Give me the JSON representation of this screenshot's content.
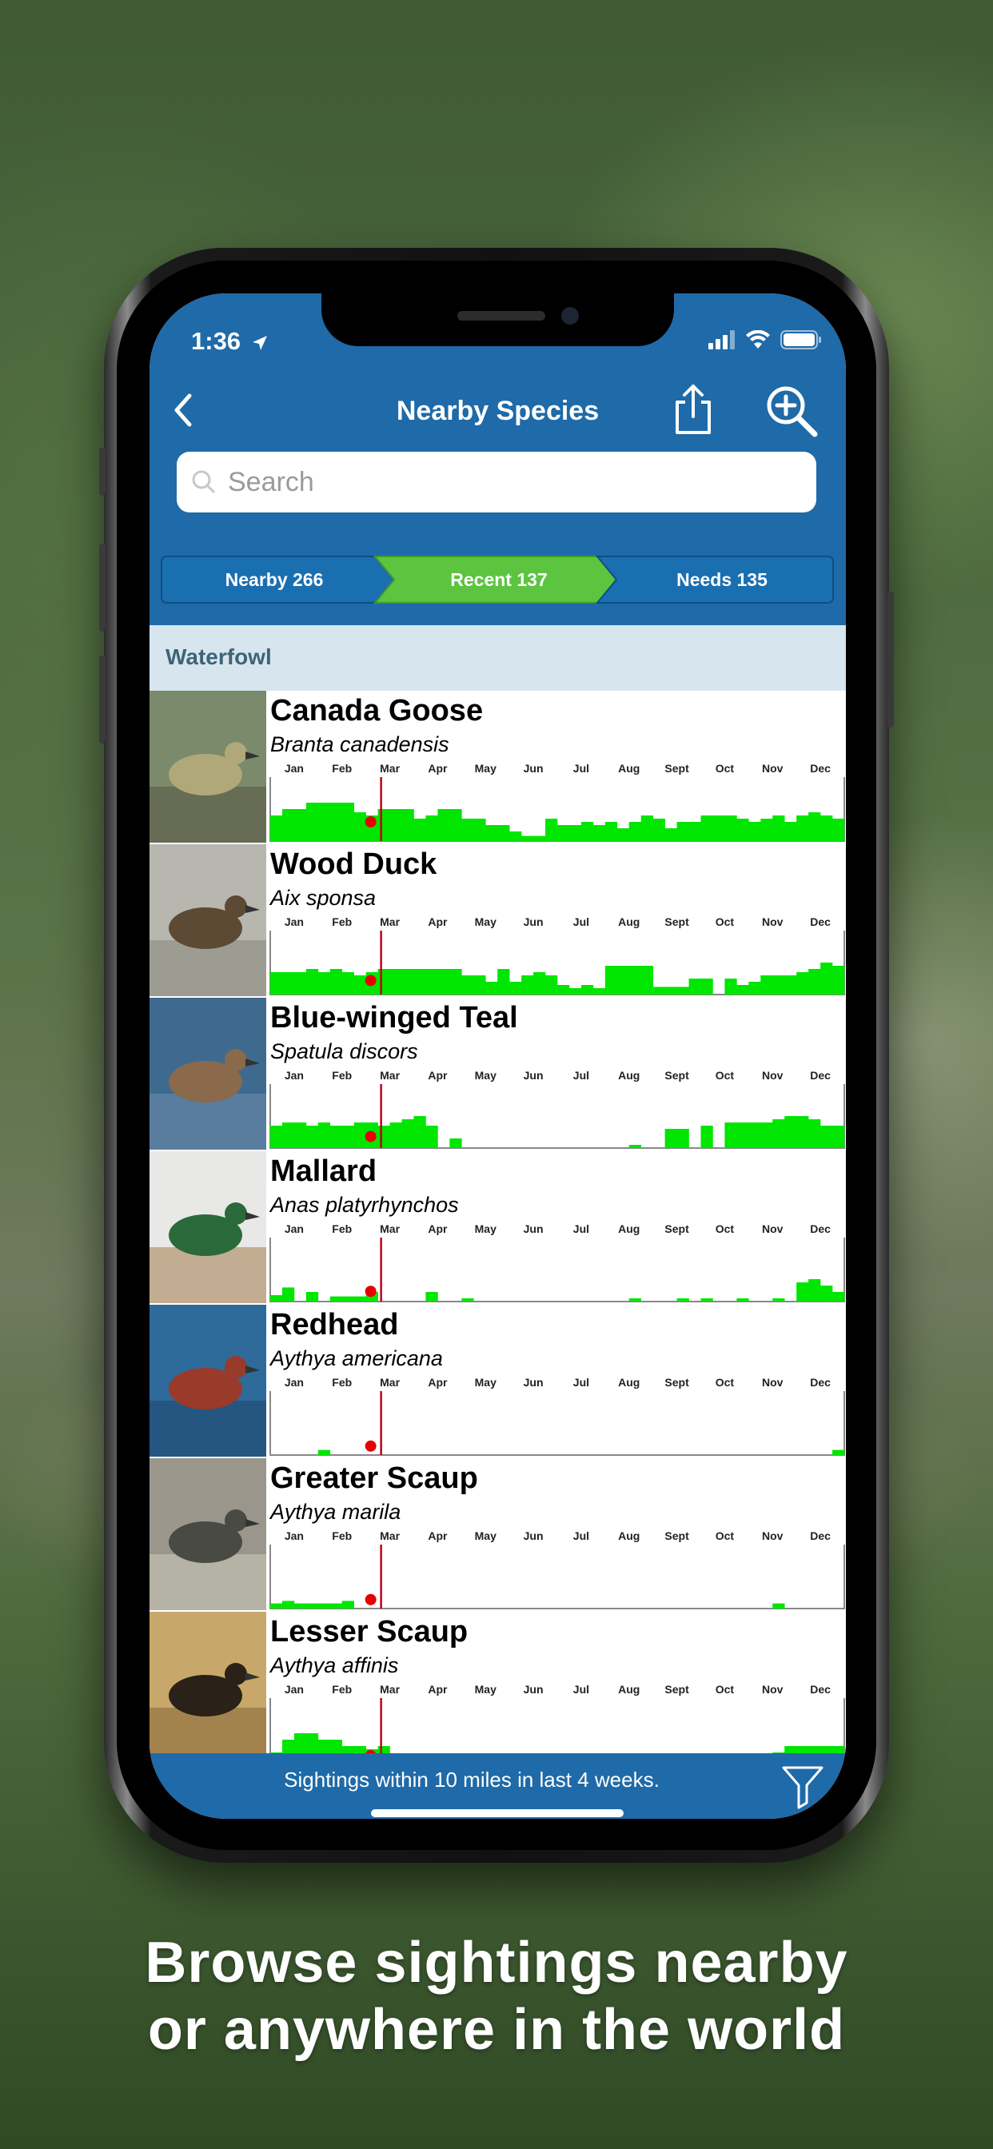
{
  "status_bar": {
    "time": "1:36"
  },
  "nav": {
    "title": "Nearby Species"
  },
  "search": {
    "placeholder": "Search"
  },
  "tabs": [
    {
      "label": "Nearby 266",
      "color": "#1a6fb0",
      "selected": false
    },
    {
      "label": "Recent 137",
      "color": "#5cc43f",
      "selected": true
    },
    {
      "label": "Needs 135",
      "color": "#1a6fb0",
      "selected": false
    }
  ],
  "section": {
    "title": "Waterfowl"
  },
  "months": [
    "Jan",
    "Feb",
    "Mar",
    "Apr",
    "May",
    "Jun",
    "Jul",
    "Aug",
    "Sept",
    "Oct",
    "Nov",
    "Dec"
  ],
  "colors": {
    "bar": "#00e600",
    "marker": "#e60000",
    "current_line": "#c0001a",
    "header": "#1f6aa8"
  },
  "chart_data": {
    "type": "bar",
    "x_unit": "week",
    "weeks_per_year": 48,
    "current_week": 9,
    "species": [
      {
        "common": "Canada Goose",
        "scientific": "Branta canadensis",
        "current_value": 0.2,
        "values": [
          0.4,
          0.5,
          0.5,
          0.6,
          0.6,
          0.6,
          0.6,
          0.45,
          0.4,
          0.5,
          0.5,
          0.5,
          0.35,
          0.4,
          0.5,
          0.5,
          0.35,
          0.35,
          0.25,
          0.25,
          0.15,
          0.08,
          0.08,
          0.35,
          0.25,
          0.25,
          0.3,
          0.25,
          0.3,
          0.2,
          0.3,
          0.4,
          0.35,
          0.2,
          0.3,
          0.3,
          0.4,
          0.4,
          0.4,
          0.35,
          0.3,
          0.35,
          0.4,
          0.3,
          0.4,
          0.45,
          0.4,
          0.35
        ]
      },
      {
        "common": "Wood Duck",
        "scientific": "Aix sponsa",
        "current_value": 0.12,
        "values": [
          0.35,
          0.35,
          0.35,
          0.4,
          0.35,
          0.4,
          0.35,
          0.3,
          0.35,
          0.4,
          0.4,
          0.4,
          0.4,
          0.4,
          0.4,
          0.4,
          0.3,
          0.3,
          0.2,
          0.4,
          0.2,
          0.3,
          0.35,
          0.3,
          0.15,
          0.1,
          0.15,
          0.1,
          0.45,
          0.45,
          0.45,
          0.45,
          0.12,
          0.12,
          0.12,
          0.25,
          0.25,
          0.0,
          0.25,
          0.15,
          0.2,
          0.3,
          0.3,
          0.3,
          0.35,
          0.4,
          0.5,
          0.45
        ]
      },
      {
        "common": "Blue-winged Teal",
        "scientific": "Spatula discors",
        "current_value": 0.08,
        "values": [
          0.35,
          0.4,
          0.4,
          0.35,
          0.4,
          0.35,
          0.35,
          0.4,
          0.4,
          0.35,
          0.4,
          0.45,
          0.5,
          0.35,
          0.0,
          0.15,
          0.0,
          0.0,
          0.0,
          0.0,
          0.0,
          0.0,
          0.0,
          0.0,
          0.0,
          0.0,
          0.0,
          0.0,
          0.0,
          0.0,
          0.05,
          0.0,
          0.0,
          0.3,
          0.3,
          0.0,
          0.35,
          0.0,
          0.4,
          0.4,
          0.4,
          0.4,
          0.45,
          0.5,
          0.5,
          0.45,
          0.35,
          0.35
        ]
      },
      {
        "common": "Mallard",
        "scientific": "Anas platyrhynchos",
        "current_value": 0.06,
        "values": [
          0.1,
          0.22,
          0.0,
          0.15,
          0.0,
          0.08,
          0.08,
          0.08,
          0.15,
          0.0,
          0.0,
          0.0,
          0.0,
          0.15,
          0.0,
          0.0,
          0.05,
          0.0,
          0.0,
          0.0,
          0.0,
          0.0,
          0.0,
          0.0,
          0.0,
          0.0,
          0.0,
          0.0,
          0.0,
          0.0,
          0.05,
          0.0,
          0.0,
          0.0,
          0.05,
          0.0,
          0.05,
          0.0,
          0.0,
          0.05,
          0.0,
          0.0,
          0.05,
          0.0,
          0.3,
          0.35,
          0.25,
          0.15
        ]
      },
      {
        "common": "Redhead",
        "scientific": "Aythya americana",
        "current_value": 0.04,
        "values": [
          0.0,
          0.0,
          0.0,
          0.0,
          0.08,
          0.0,
          0.0,
          0.0,
          0.0,
          0.0,
          0.0,
          0.0,
          0.0,
          0.0,
          0.0,
          0.0,
          0.0,
          0.0,
          0.0,
          0.0,
          0.0,
          0.0,
          0.0,
          0.0,
          0.0,
          0.0,
          0.0,
          0.0,
          0.0,
          0.0,
          0.0,
          0.0,
          0.0,
          0.0,
          0.0,
          0.0,
          0.0,
          0.0,
          0.0,
          0.0,
          0.0,
          0.0,
          0.0,
          0.0,
          0.0,
          0.0,
          0.0,
          0.08
        ]
      },
      {
        "common": "Greater Scaup",
        "scientific": "Aythya marila",
        "current_value": 0.04,
        "values": [
          0.08,
          0.12,
          0.08,
          0.08,
          0.08,
          0.08,
          0.12,
          0.0,
          0.0,
          0.0,
          0.0,
          0.0,
          0.0,
          0.0,
          0.0,
          0.0,
          0.0,
          0.0,
          0.0,
          0.0,
          0.0,
          0.0,
          0.0,
          0.0,
          0.0,
          0.0,
          0.0,
          0.0,
          0.0,
          0.0,
          0.0,
          0.0,
          0.0,
          0.0,
          0.0,
          0.0,
          0.0,
          0.0,
          0.0,
          0.0,
          0.0,
          0.0,
          0.08,
          0.0,
          0.0,
          0.0,
          0.0,
          0.0
        ]
      },
      {
        "common": "Lesser Scaup",
        "scientific": "Aythya affinis",
        "current_value": 0.0,
        "values": [
          0.15,
          0.35,
          0.45,
          0.45,
          0.35,
          0.35,
          0.25,
          0.25,
          0.2,
          0.25,
          0.0,
          0.0,
          0.0,
          0.0,
          0.0,
          0.0,
          0.0,
          0.0,
          0.0,
          0.0,
          0.0,
          0.0,
          0.0,
          0.0,
          0.0,
          0.0,
          0.0,
          0.0,
          0.0,
          0.0,
          0.0,
          0.0,
          0.0,
          0.0,
          0.0,
          0.0,
          0.0,
          0.0,
          0.0,
          0.0,
          0.0,
          0.0,
          0.15,
          0.25,
          0.25,
          0.25,
          0.25,
          0.25
        ]
      }
    ]
  },
  "footer": {
    "text": "Sightings within 10 miles in last 4 weeks."
  },
  "caption": {
    "line1": "Browse sightings nearby",
    "line2": "or anywhere in the world"
  },
  "icons": {
    "back": "chevron-left-icon",
    "share": "share-icon",
    "zoom": "zoom-in-icon",
    "search": "search-icon",
    "filter": "filter-icon",
    "signal": "cellular-signal-icon",
    "wifi": "wifi-icon",
    "battery": "battery-icon",
    "location": "location-arrow-icon"
  }
}
